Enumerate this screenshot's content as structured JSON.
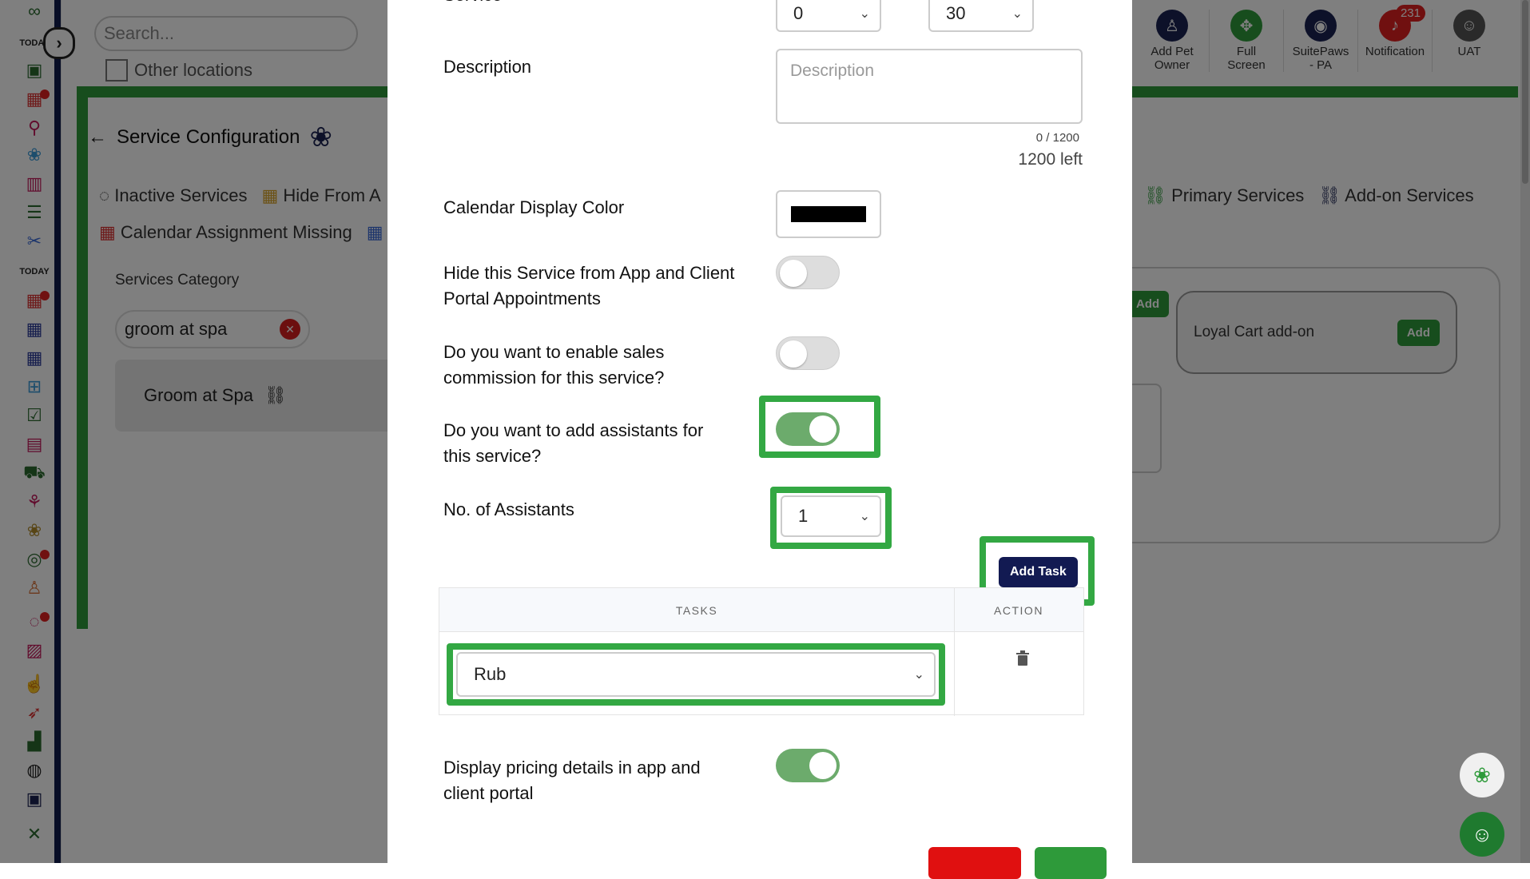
{
  "search": {
    "placeholder": "Search..."
  },
  "other_locations": "Other locations",
  "top_actions": [
    {
      "line1": "Add Pet",
      "line2": "Owner",
      "icon": "add-user-icon",
      "color": "#1b2352"
    },
    {
      "line1": "Full",
      "line2": "Screen",
      "icon": "fullscreen-icon",
      "color": "#2e9a3a"
    },
    {
      "line1": "SuitePaws",
      "line2": "- PA",
      "icon": "location-pin-icon",
      "color": "#1b2352"
    },
    {
      "line1": "Notification",
      "line2": "",
      "icon": "bell-icon",
      "color": "#e02020",
      "badge": "231"
    },
    {
      "line1": "UAT",
      "line2": "",
      "icon": "avatar",
      "color": "#555555"
    }
  ],
  "page": {
    "title": "Service Configuration",
    "filters_row1": [
      "Inactive Services",
      "Hide From A"
    ],
    "filters_row2": [
      "Calendar Assignment Missing"
    ],
    "right_filters": [
      "Primary Services",
      "Add-on Services"
    ],
    "category_label": "Services Category",
    "category_chip": "groom at spa",
    "service_row": "Groom at Spa",
    "addon_card": "Loyal Cart add-on",
    "addon_btn": "Add",
    "mini_add": "Add"
  },
  "modal": {
    "service_label": "Service",
    "service_select_1": "0",
    "service_select_2": "30",
    "description_label": "Description",
    "description_placeholder": "Description",
    "char_count": "0 / 1200",
    "chars_left": "1200 left",
    "calendar_color_label": "Calendar Display Color",
    "calendar_color": "#000000",
    "hide_label_1": "Hide this Service from App and Client",
    "hide_label_2": "Portal Appointments",
    "hide_toggle": false,
    "commission_label_1": "Do you want to enable sales",
    "commission_label_2": "commission for this service?",
    "commission_toggle": false,
    "assistants_label_1": "Do you want to add assistants for",
    "assistants_label_2": "this service?",
    "assistants_toggle": true,
    "num_assistants_label": "No. of Assistants",
    "num_assistants": "1",
    "add_task_label": "Add Task",
    "tasks_header": "TASKS",
    "action_header": "ACTION",
    "task_value": "Rub",
    "pricing_label_1": "Display pricing details in app and",
    "pricing_label_2": "client portal",
    "pricing_toggle": true
  },
  "colors": {
    "brand_green": "#2e9a3a",
    "navy": "#121a52",
    "toggle_on": "#6cab6c",
    "highlight": "#33a843"
  }
}
